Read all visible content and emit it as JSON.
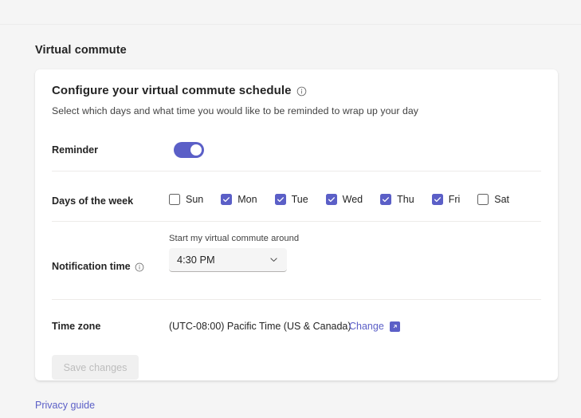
{
  "page": {
    "title": "Virtual commute",
    "privacy_link": "Privacy guide"
  },
  "card": {
    "heading": "Configure your virtual commute schedule",
    "heading_info_icon": "info-icon",
    "subtitle": "Select which days and what time you would like to be reminded to wrap up your day",
    "reminder": {
      "label": "Reminder",
      "enabled": true
    },
    "days": {
      "label": "Days of the week",
      "items": [
        {
          "label": "Sun",
          "checked": false
        },
        {
          "label": "Mon",
          "checked": true
        },
        {
          "label": "Tue",
          "checked": true
        },
        {
          "label": "Wed",
          "checked": true
        },
        {
          "label": "Thu",
          "checked": true
        },
        {
          "label": "Fri",
          "checked": true
        },
        {
          "label": "Sat",
          "checked": false
        }
      ]
    },
    "notification_time": {
      "label": "Notification time",
      "info_icon": "info-icon",
      "field_label": "Start my virtual commute around",
      "value": "4:30 PM",
      "chevron_icon": "chevron-down-icon"
    },
    "time_zone": {
      "label": "Time zone",
      "value": "(UTC-08:00) Pacific Time (US & Canada)",
      "change_label": "Change",
      "change_icon": "external-link-icon"
    },
    "save_button": {
      "label": "Save changes",
      "disabled": true
    }
  },
  "colors": {
    "brand_purple": "#5B5FC7",
    "page_background": "#F5F5F5",
    "card_background": "#FFFFFF",
    "text_primary": "#242424",
    "text_secondary": "#424242",
    "divider": "#EDEBE9",
    "disabled_button_bg": "#F0F0F0",
    "disabled_button_text": "#BDBDBD"
  }
}
